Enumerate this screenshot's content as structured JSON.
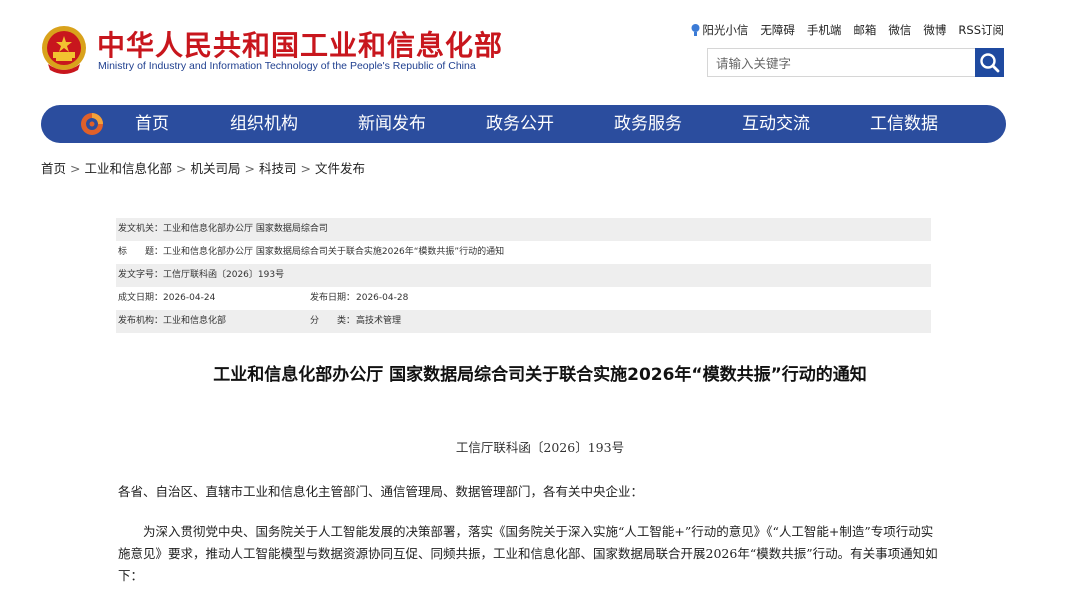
{
  "header": {
    "title": "中华人民共和国工业和信息化部",
    "subtitle": "Ministry of Industry and Information Technology of the People's Republic of China",
    "emblem_icon": "national-emblem-icon"
  },
  "toplinks": [
    "阳光小信",
    "无障碍",
    "手机端",
    "邮箱",
    "微信",
    "微博",
    "RSS订阅"
  ],
  "search": {
    "placeholder": "请输入关键字",
    "icon": "search-icon"
  },
  "nav": {
    "logo_icon": "miit-logo-icon",
    "items": [
      "首页",
      "组织机构",
      "新闻发布",
      "政务公开",
      "政务服务",
      "互动交流",
      "工信数据"
    ]
  },
  "breadcrumb": [
    "首页",
    "工业和信息化部",
    "机关司局",
    "科技司",
    "文件发布"
  ],
  "info": {
    "issuer_label": "发文机关：",
    "issuer_value": "工业和信息化部办公厅 国家数据局综合司",
    "title_label": "标　　题：",
    "title_value": "工业和信息化部办公厅 国家数据局综合司关于联合实施2026年“模数共振”行动的通知",
    "docno_label": "发文字号：",
    "docno_value": "工信厅联科函〔2026〕193号",
    "created_label": "成文日期：",
    "created_value": "2026-04-24",
    "published_label": "发布日期：",
    "published_value": "2026-04-28",
    "org_label": "发布机构：",
    "org_value": "工业和信息化部",
    "category_label": "分　　类：",
    "category_value": "高技术管理"
  },
  "article": {
    "title": "工业和信息化部办公厅 国家数据局综合司关于联合实施2026年“模数共振”行动的通知",
    "doc_number": "工信厅联科函〔2026〕193号",
    "salutation": "各省、自治区、直辖市工业和信息化主管部门、通信管理局、数据管理部门，各有关中央企业：",
    "para_lines": [
      "　　为深入贯彻党中央、国务院关于人工智能发展的决策部署，落实《国务院关于深入实施“人工智能+”行动的意见》《“人工智能+制造”专项行动实",
      "施意见》要求，推动人工智能模型与数据资源协同互促、同频共振，工业和信息化部、国家数据局联合开展2026年“模数共振”行动。有关事项通知如",
      "下："
    ]
  },
  "colors": {
    "brand_red": "#c8161d",
    "nav_blue": "#2b4d9e",
    "info_shade": "#eeeeee"
  }
}
